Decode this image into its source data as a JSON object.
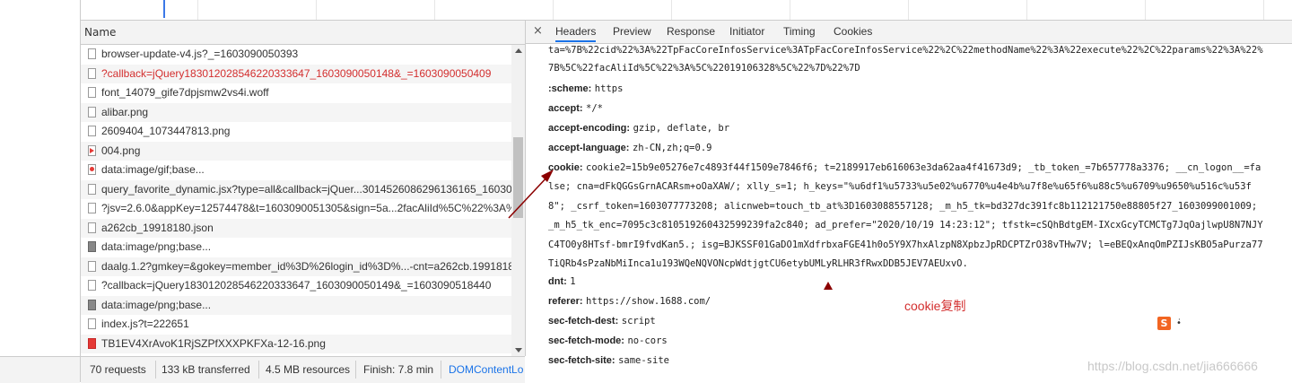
{
  "name_panel": {
    "header": "Name",
    "rows": [
      {
        "label": "browser-update-v4.js?_=1603090050393",
        "error": false,
        "icon": "file-icon"
      },
      {
        "label": "?callback=jQuery18301202854622033364​7_1603090050148&_=1603090050409",
        "error": true,
        "icon": "file-icon"
      },
      {
        "label": "font_14079_gife7dpjsmw2vs4i.woff",
        "error": false,
        "icon": "file-icon"
      },
      {
        "label": "alibar.png",
        "error": false,
        "icon": "file-icon"
      },
      {
        "label": "2609404_1073447813.png",
        "error": false,
        "icon": "file-icon"
      },
      {
        "label": "004.png",
        "error": false,
        "icon": "image-icon"
      },
      {
        "label": "data:image/gif;base...",
        "error": false,
        "icon": "gif-icon"
      },
      {
        "label": "query_favorite_dynamic.jsx?type=all&callback=jQuer...3014526086296136165_160309",
        "error": false,
        "icon": "file-icon"
      },
      {
        "label": "?jsv=2.6.0&appKey=12574478&t=1603090051305&sign=5a...2facAliId%5C%22%3A%",
        "error": false,
        "icon": "file-icon"
      },
      {
        "label": "a262cb_19918180.json",
        "error": false,
        "icon": "file-icon"
      },
      {
        "label": "data:image/png;base...",
        "error": false,
        "icon": "png-data-icon"
      },
      {
        "label": "daalg.1.2?gmkey=&gokey=member_id%3D%26login_id%3D%...-cnt=a262cb.1991818",
        "error": false,
        "icon": "file-icon"
      },
      {
        "label": "?callback=jQuery18301202854622033364​7_1603090050149&_=1603090518440",
        "error": false,
        "icon": "file-icon"
      },
      {
        "label": "data:image/png;base...",
        "error": false,
        "icon": "png-data-icon"
      },
      {
        "label": "index.js?t=222651",
        "error": false,
        "icon": "file-icon"
      },
      {
        "label": "TB1EV4XrAvoK1RjSZPfXXXPKFXa-12-16.png",
        "error": false,
        "icon": "png-red-icon"
      }
    ]
  },
  "status_bar": {
    "requests": "70 requests",
    "transferred": "133 kB transferred",
    "resources": "4.5 MB resources",
    "finish": "Finish: 7.8 min",
    "dom_content": "DOMContentLo"
  },
  "tabs": [
    "Headers",
    "Preview",
    "Response",
    "Initiator",
    "Timing",
    "Cookies"
  ],
  "close_glyph": "×",
  "headers": {
    "ta_line1": "ta=%7B%22cid%22%3A%22TpFacCoreInfosService%3ATpFacCoreInfosService%22%2C%22methodName%22%3A%22execute%22%2C%22params%22%3A%22%",
    "ta_line2": "7B%5C%22facAliId%5C%22%3A%5C%22019106328%5C%22%7D%22%7D",
    "scheme_k": ":scheme:",
    "scheme_v": "https",
    "accept_k": "accept:",
    "accept_v": "*/*",
    "enc_k": "accept-encoding:",
    "enc_v": "gzip, deflate, br",
    "lang_k": "accept-language:",
    "lang_v": "zh-CN,zh;q=0.9",
    "cookie_k": "cookie:",
    "cookie_v1": "cookie2=15b9e05276e7c4893f44f1509e7846f6; t=2189917eb616063e3da62aa4f41673d9; _tb_token_=7b657778a3376; __cn_logon__=fa",
    "cookie_v2": "lse; cna=dFkQGGsGrnACARsm+oOaXAW/; xlly_s=1; h_keys=\"%u6df1%u5733%u5e02%u6770%u4e4b%u7f8e%u65f6%u88c5%u6709%u9650%u516c%u53f",
    "cookie_v3": "8\"; _csrf_token=1603077773208; alicnweb=touch_tb_at%3D1603088557128; _m_h5_tk=bd327dc391fc8b112121750e88805f27_1603099001009;",
    "cookie_v4": "_m_h5_tk_enc=7095c3c810519260432599239fa2c840; ad_prefer=\"2020/10/19 14:23:12\"; tfstk=cSQhBdtgEM-IXcxGcyTCMCTg7JqOajlwpU8N7NJY",
    "cookie_v5": "C4TO0y8HTsf-bmrI9fvdKan5.; isg=BJKSSF01GaDO1mXdfrbxaFGE41h0o5Y9X7hxAlzpN8XpbzJpRDCPTZrO38vTHw7V; l=eBEQxAnqOmPZIJsKBO5aPurza77",
    "cookie_v6": "TiQRb4sPzaNbMiInca1u193WQeNQVONcpWdtjgtCU6etybUMLyRLHR3fRwxDDB5JEV7AEUxvO.",
    "dnt_k": "dnt:",
    "dnt_v": "1",
    "referer_k": "referer:",
    "referer_v": "https://show.1688.com/",
    "dest_k": "sec-fetch-dest:",
    "dest_v": "script",
    "mode_k": "sec-fetch-mode:",
    "mode_v": "no-cors",
    "site_k": "sec-fetch-site:",
    "site_v": "same-site"
  },
  "annotation": "cookie复制",
  "ime": {
    "logo": "S",
    "menu": "•̇"
  },
  "watermark": "https://blog.csdn.net/jia666666",
  "colors": {
    "error": "#d32f2f",
    "accent": "#1a73e8",
    "arrow": "#8b0000"
  }
}
